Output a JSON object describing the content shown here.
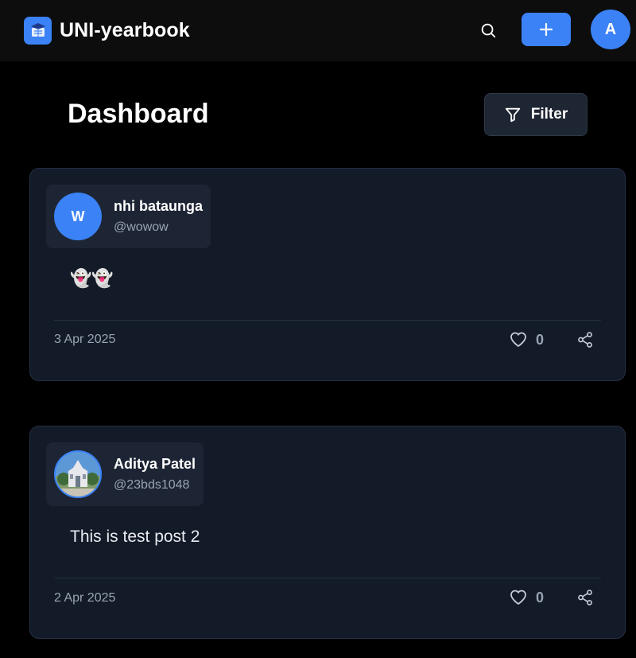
{
  "header": {
    "brand_name": "UNI-yearbook",
    "brand_icon": "graduation-cap-icon",
    "search_icon": "search-icon",
    "add_icon": "plus-icon",
    "user_avatar_initial": "A",
    "accent_color": "#3b82f6"
  },
  "main": {
    "title": "Dashboard",
    "filter_label": "Filter",
    "filter_icon": "funnel-icon"
  },
  "posts": [
    {
      "author_name": "nhi bataunga",
      "author_handle": "@wowow",
      "avatar_initial": "W",
      "content": "👻👻",
      "date": "3 Apr 2025",
      "likes": "0"
    },
    {
      "author_name": "Aditya Patel",
      "author_handle": "@23bds1048",
      "avatar_initial": "",
      "content": "This is test post 2",
      "date": "2 Apr 2025",
      "likes": "0"
    }
  ]
}
